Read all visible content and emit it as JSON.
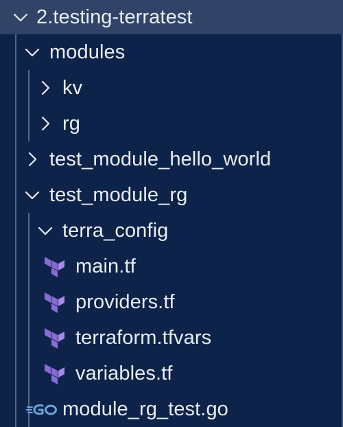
{
  "explorer": {
    "root": {
      "label": "2.testing-terratest",
      "expanded": true
    },
    "items": [
      {
        "label": "modules",
        "type": "folder",
        "expanded": true,
        "depth": 1
      },
      {
        "label": "kv",
        "type": "folder",
        "expanded": false,
        "depth": 2
      },
      {
        "label": "rg",
        "type": "folder",
        "expanded": false,
        "depth": 2
      },
      {
        "label": "test_module_hello_world",
        "type": "folder",
        "expanded": false,
        "depth": 1
      },
      {
        "label": "test_module_rg",
        "type": "folder",
        "expanded": true,
        "depth": 1
      },
      {
        "label": "terra_config",
        "type": "folder",
        "expanded": true,
        "depth": 2
      },
      {
        "label": "main.tf",
        "type": "terraform-file",
        "depth": 3
      },
      {
        "label": "providers.tf",
        "type": "terraform-file",
        "depth": 3
      },
      {
        "label": "terraform.tfvars",
        "type": "terraform-file",
        "depth": 3
      },
      {
        "label": "variables.tf",
        "type": "terraform-file",
        "depth": 3
      },
      {
        "label": "module_rg_test.go",
        "type": "go-file",
        "depth": 2
      }
    ]
  },
  "icons": {
    "chevron_down": "chevron-down-icon",
    "chevron_right": "chevron-right-icon",
    "terraform": "terraform-icon",
    "go": "go-file-icon"
  },
  "colors": {
    "background": "#0d2349",
    "header_background": "#314468",
    "text": "#e9edf3",
    "terraform_purple": "#8a6bd6",
    "go_blue": "#6aa6d8"
  }
}
